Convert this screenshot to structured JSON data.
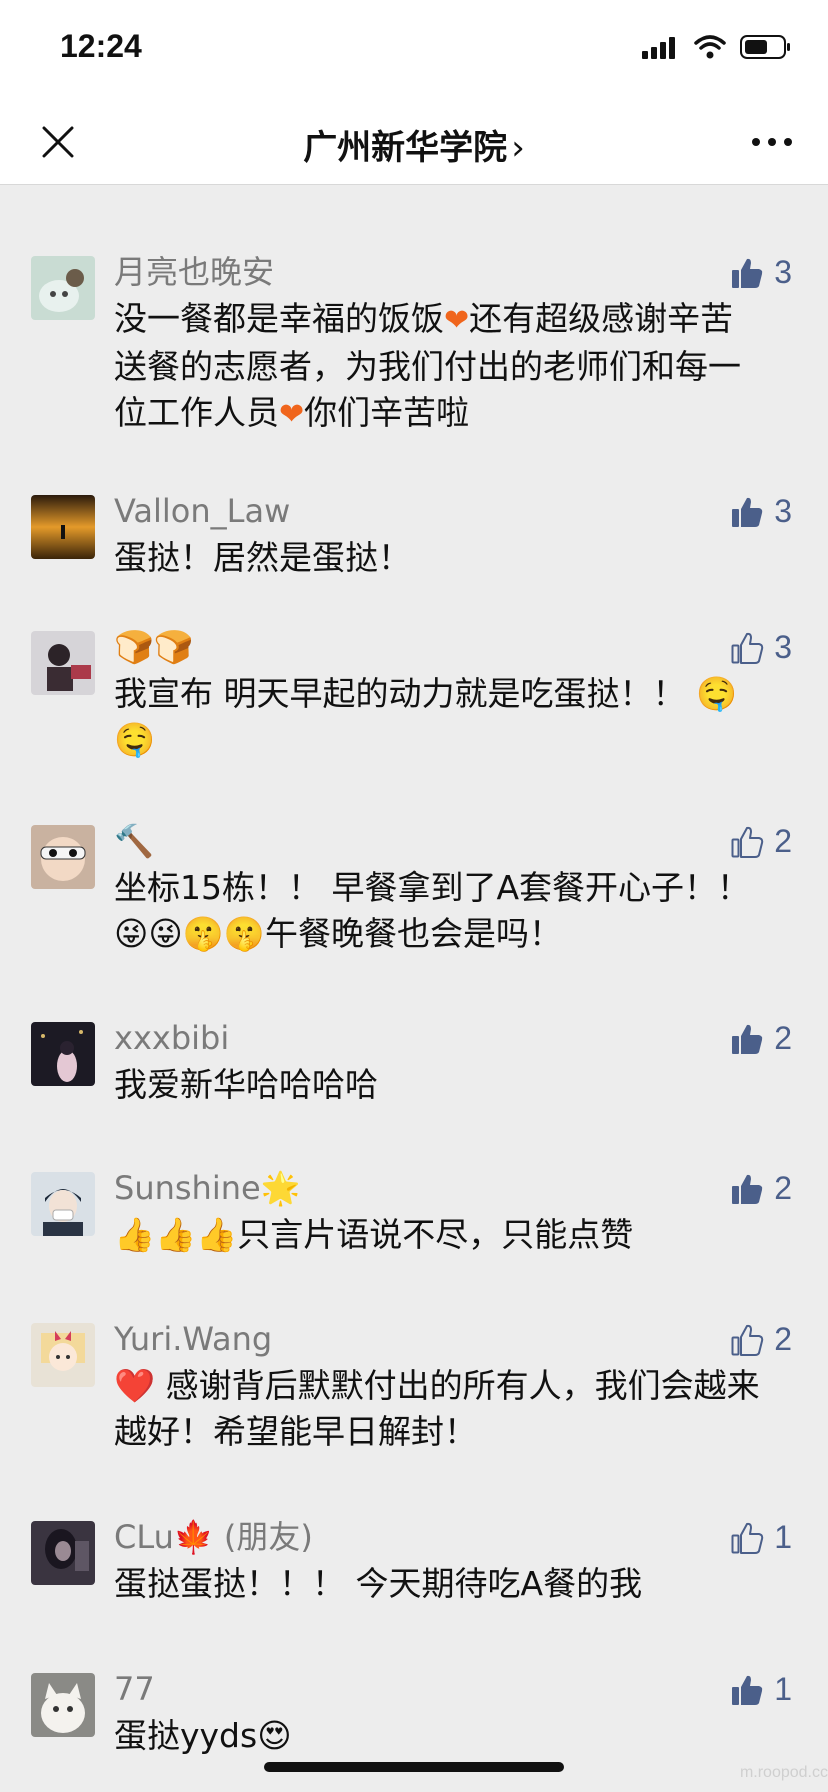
{
  "status": {
    "time": "12:24"
  },
  "nav": {
    "title": "广州新华学院",
    "chevron": "›"
  },
  "colors": {
    "like_filled": "#4b5f8a",
    "accent_heart": "#f0651c"
  },
  "comments": [
    {
      "name": "月亮也晚安",
      "text_parts": [
        "没一餐都是幸福的饭饭",
        "❤",
        "还有超级感谢辛苦送餐的志愿者，为我们付出的老师们和每一位工作人员",
        "❤",
        "你们辛苦啦"
      ],
      "likes": "3",
      "liked": true
    },
    {
      "name": "Vallon_Law",
      "text": "蛋挞！居然是蛋挞！",
      "likes": "3",
      "liked": true
    },
    {
      "name": "🍞🍞",
      "text": "我宣布 明天早起的动力就是吃蛋挞！！ 🤤🤤",
      "likes": "3",
      "liked": false
    },
    {
      "name": "🔨",
      "text": "坐标15栋！！ 早餐拿到了A套餐开心子！！ 😜😜🤫🤫午餐晚餐也会是吗！",
      "likes": "2",
      "liked": false
    },
    {
      "name": "xxxbibi",
      "text": "我爱新华哈哈哈哈",
      "likes": "2",
      "liked": true
    },
    {
      "name": "Sunshine🌟",
      "text": "👍👍👍只言片语说不尽，只能点赞",
      "likes": "2",
      "liked": true
    },
    {
      "name": "Yuri.Wang",
      "text": "❤️ 感谢背后默默付出的所有人，我们会越来越好！希望能早日解封！",
      "likes": "2",
      "liked": false
    },
    {
      "name": "CLu🍁",
      "friend": "(朋友)",
      "text": "蛋挞蛋挞！！！ 今天期待吃A餐的我",
      "likes": "1",
      "liked": false
    },
    {
      "name": "77",
      "text": "蛋挞yyds😍",
      "likes": "1",
      "liked": true
    }
  ],
  "watermark": "m.roopod.cc"
}
